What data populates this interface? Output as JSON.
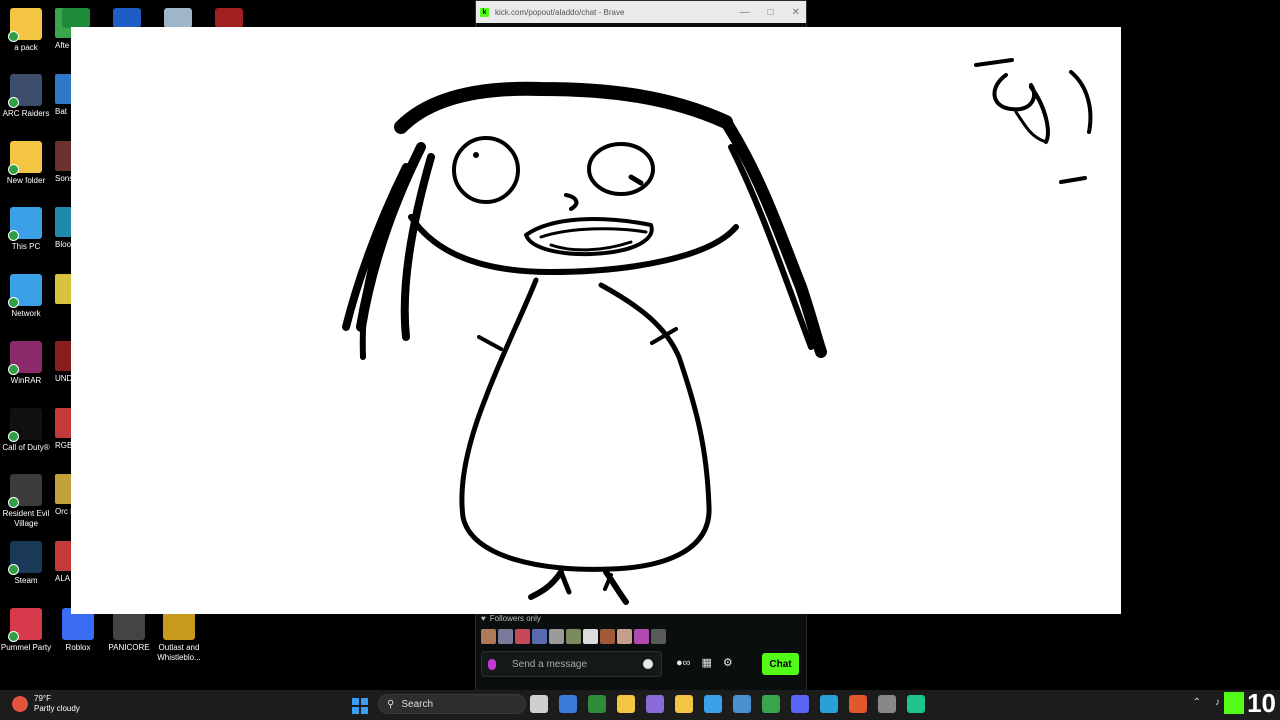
{
  "desktop": {
    "icons": [
      {
        "label": "a pack",
        "color": "#f4c542"
      },
      {
        "label": "ARC Raiders",
        "color": "#3c4d6b"
      },
      {
        "label": "New folder",
        "color": "#f4c542"
      },
      {
        "label": "This PC",
        "color": "#3aa0e8"
      },
      {
        "label": "Network",
        "color": "#3aa0e8"
      },
      {
        "label": "WinRAR",
        "color": "#8b2a6b"
      },
      {
        "label": "Call of Duty®",
        "color": "#111111"
      },
      {
        "label": "Resident Evil Village",
        "color": "#3b3b3b"
      },
      {
        "label": "Steam",
        "color": "#1b3a5a"
      },
      {
        "label": "Pummel Party",
        "color": "#d63a4b"
      }
    ],
    "bottom_icons": [
      {
        "label": "Roblox",
        "color": "#3a6cf4"
      },
      {
        "label": "PANICORE",
        "color": "#444444"
      },
      {
        "label": "Outlast and Whistleblo...",
        "color": "#c79a1d"
      }
    ],
    "partial_icons": [
      {
        "label": "Afte",
        "color": "#3aa54a"
      },
      {
        "label": "Bat",
        "color": "#2f78c8"
      },
      {
        "label": "Sons F",
        "color": "#6b3030"
      },
      {
        "label": "Bloo M",
        "color": "#1f8aa8"
      },
      {
        "label": "",
        "color": "#d7c43a"
      },
      {
        "label": "UNDE",
        "color": "#8a1c1c"
      },
      {
        "label": "RGB",
        "color": "#c43a3a"
      },
      {
        "label": "Orc Die",
        "color": "#c4a03a"
      },
      {
        "label": "ALA Ch",
        "color": "#c43a3a"
      }
    ],
    "top_icons": [
      {
        "name": "xbox-icon",
        "color": "#1f8a3a"
      },
      {
        "name": "game-controller-icon",
        "color": "#1f5cc4"
      },
      {
        "name": "recycle-bin-icon",
        "color": "#9fb6c8"
      },
      {
        "name": "diablo-icon",
        "color": "#a01f1f"
      }
    ]
  },
  "browser": {
    "title": "kick.com/popout/aladdo/chat - Brave",
    "logo_letter": "k"
  },
  "drawing": {
    "scribble_text": "رقا"
  },
  "chat": {
    "mode_label": "Followers only",
    "placeholder": "Send a message",
    "chat_button": "Chat",
    "emote_colors": [
      "#b07a5a",
      "#7a7a9a",
      "#c44a5a",
      "#5a6ab0",
      "#9a9a9a",
      "#7a8a5a",
      "#dcdcdc",
      "#a05a3a",
      "#c4a08a",
      "#b04ab0",
      "#5a5a5a"
    ]
  },
  "taskbar": {
    "weather_temp": "79°F",
    "weather_desc": "Partly cloudy",
    "search_label": "Search",
    "app_colors": [
      "#cfcfcf",
      "#3a7ad8",
      "#2f8a3a",
      "#f4c542",
      "#8a6ad8",
      "#f4c542",
      "#3aa0e8",
      "#4a90d0",
      "#3aa54a",
      "#5865f2",
      "#2aa0d8",
      "#e0572a",
      "#888888",
      "#1fc48a"
    ],
    "badge_number": "10"
  },
  "colors": {
    "kick_green": "#53fc18"
  }
}
